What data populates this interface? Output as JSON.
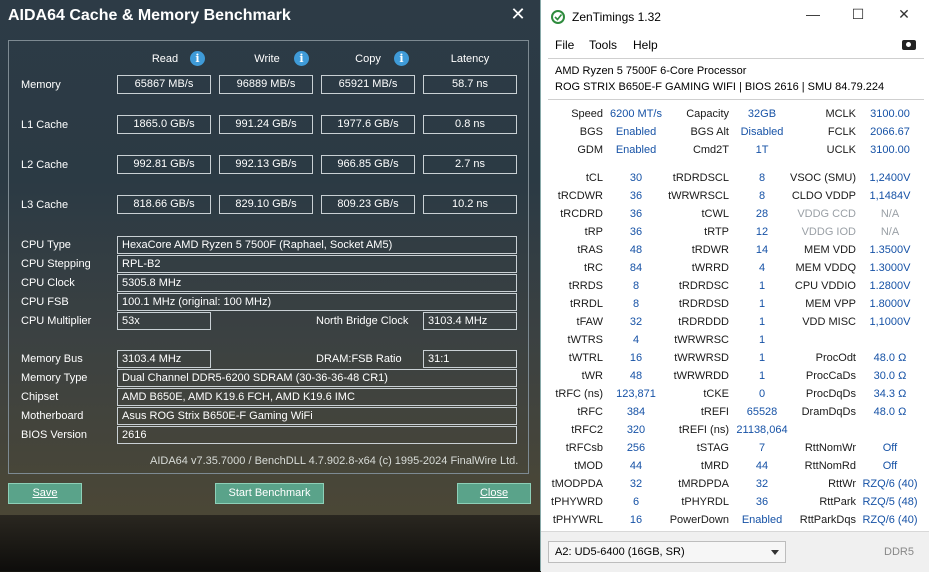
{
  "aida": {
    "title": "AIDA64 Cache & Memory Benchmark",
    "close_glyph": "✕",
    "columns": {
      "read": "Read",
      "write": "Write",
      "copy": "Copy",
      "latency": "Latency"
    },
    "info_glyph": "i",
    "rows": [
      {
        "label": "Memory",
        "read": "65867 MB/s",
        "write": "96889 MB/s",
        "copy": "65921 MB/s",
        "latency": "58.7 ns"
      },
      {
        "label": "L1 Cache",
        "read": "1865.0 GB/s",
        "write": "991.24 GB/s",
        "copy": "1977.6 GB/s",
        "latency": "0.8 ns"
      },
      {
        "label": "L2 Cache",
        "read": "992.81 GB/s",
        "write": "992.13 GB/s",
        "copy": "966.85 GB/s",
        "latency": "2.7 ns"
      },
      {
        "label": "L3 Cache",
        "read": "818.66 GB/s",
        "write": "829.10 GB/s",
        "copy": "809.23 GB/s",
        "latency": "10.2 ns"
      }
    ],
    "cpu": {
      "type_label": "CPU Type",
      "type": "HexaCore AMD Ryzen 5 7500F  (Raphael, Socket AM5)",
      "stepping_label": "CPU Stepping",
      "stepping": "RPL-B2",
      "clock_label": "CPU Clock",
      "clock": "5305.8 MHz",
      "fsb_label": "CPU FSB",
      "fsb": "100.1 MHz  (original: 100 MHz)",
      "mult_label": "CPU Multiplier",
      "mult": "53x",
      "nb_label": "North Bridge Clock",
      "nb": "3103.4 MHz"
    },
    "mem": {
      "bus_label": "Memory Bus",
      "bus": "3103.4 MHz",
      "ratio_label": "DRAM:FSB Ratio",
      "ratio": "31:1",
      "type_label": "Memory Type",
      "type": "Dual Channel DDR5-6200 SDRAM  (30-36-36-48 CR1)",
      "chipset_label": "Chipset",
      "chipset": "AMD B650E, AMD K19.6 FCH, AMD K19.6 IMC",
      "mobo_label": "Motherboard",
      "mobo": "Asus ROG Strix B650E-F Gaming WiFi",
      "bios_label": "BIOS Version",
      "bios": "2616"
    },
    "footer": "AIDA64 v7.35.7000 / BenchDLL 4.7.902.8-x64  (c) 1995-2024 FinalWire Ltd.",
    "buttons": {
      "save": "Save",
      "start": "Start Benchmark",
      "close": "Close"
    }
  },
  "zen": {
    "title": "ZenTimings 1.32",
    "window_controls": {
      "minimize": "—",
      "maximize": "☐",
      "close": "✕"
    },
    "menu": {
      "file": "File",
      "tools": "Tools",
      "help": "Help"
    },
    "cpu_name": "AMD Ryzen 5 7500F 6-Core Processor",
    "board_info": "ROG STRIX B650E-F GAMING WIFI | BIOS 2616 | SMU 84.79.224",
    "top": [
      [
        {
          "l": "Speed",
          "v": "6200 MT/s"
        },
        {
          "l": "Capacity",
          "v": "32GB"
        },
        {
          "l": "MCLK",
          "v": "3100.00"
        }
      ],
      [
        {
          "l": "BGS",
          "v": "Enabled"
        },
        {
          "l": "BGS Alt",
          "v": "Disabled"
        },
        {
          "l": "FCLK",
          "v": "2066.67"
        }
      ],
      [
        {
          "l": "GDM",
          "v": "Enabled"
        },
        {
          "l": "Cmd2T",
          "v": "1T"
        },
        {
          "l": "UCLK",
          "v": "3100.00"
        }
      ]
    ],
    "timings": [
      [
        {
          "l": "tCL",
          "v": "30"
        },
        {
          "l": "tRDRDSCL",
          "v": "8"
        },
        {
          "l": "VSOC (SMU)",
          "v": "1,2400V"
        }
      ],
      [
        {
          "l": "tRCDWR",
          "v": "36"
        },
        {
          "l": "tWRWRSCL",
          "v": "8"
        },
        {
          "l": "CLDO VDDP",
          "v": "1,1484V"
        }
      ],
      [
        {
          "l": "tRCDRD",
          "v": "36"
        },
        {
          "l": "tCWL",
          "v": "28"
        },
        {
          "l": "VDDG CCD",
          "v": "N/A",
          "dim": true
        }
      ],
      [
        {
          "l": "tRP",
          "v": "36"
        },
        {
          "l": "tRTP",
          "v": "12"
        },
        {
          "l": "VDDG IOD",
          "v": "N/A",
          "dim": true
        }
      ],
      [
        {
          "l": "tRAS",
          "v": "48"
        },
        {
          "l": "tRDWR",
          "v": "14"
        },
        {
          "l": "MEM VDD",
          "v": "1.3500V"
        }
      ],
      [
        {
          "l": "tRC",
          "v": "84"
        },
        {
          "l": "tWRRD",
          "v": "4"
        },
        {
          "l": "MEM VDDQ",
          "v": "1.3000V"
        }
      ],
      [
        {
          "l": "tRRDS",
          "v": "8"
        },
        {
          "l": "tRDRDSC",
          "v": "1"
        },
        {
          "l": "CPU VDDIO",
          "v": "1.2800V"
        }
      ],
      [
        {
          "l": "tRRDL",
          "v": "8"
        },
        {
          "l": "tRDRDSD",
          "v": "1"
        },
        {
          "l": "MEM VPP",
          "v": "1.8000V"
        }
      ],
      [
        {
          "l": "tFAW",
          "v": "32"
        },
        {
          "l": "tRDRDDD",
          "v": "1"
        },
        {
          "l": "VDD MISC",
          "v": "1,1000V"
        }
      ],
      [
        {
          "l": "tWTRS",
          "v": "4"
        },
        {
          "l": "tWRWRSC",
          "v": "1"
        },
        null
      ],
      [
        {
          "l": "tWTRL",
          "v": "16"
        },
        {
          "l": "tWRWRSD",
          "v": "1"
        },
        {
          "l": "ProcOdt",
          "v": "48.0 Ω"
        }
      ],
      [
        {
          "l": "tWR",
          "v": "48"
        },
        {
          "l": "tWRWRDD",
          "v": "1"
        },
        {
          "l": "ProcCaDs",
          "v": "30.0 Ω"
        }
      ],
      [
        {
          "l": "tRFC (ns)",
          "v": "123,871"
        },
        {
          "l": "tCKE",
          "v": "0"
        },
        {
          "l": "ProcDqDs",
          "v": "34.3 Ω"
        }
      ],
      [
        {
          "l": "tRFC",
          "v": "384"
        },
        {
          "l": "tREFI",
          "v": "65528"
        },
        {
          "l": "DramDqDs",
          "v": "48.0 Ω"
        }
      ],
      [
        {
          "l": "tRFC2",
          "v": "320"
        },
        {
          "l": "tREFI (ns)",
          "v": "21138,064"
        },
        null
      ],
      [
        {
          "l": "tRFCsb",
          "v": "256"
        },
        {
          "l": "tSTAG",
          "v": "7"
        },
        {
          "l": "RttNomWr",
          "v": "Off"
        }
      ],
      [
        {
          "l": "tMOD",
          "v": "44"
        },
        {
          "l": "tMRD",
          "v": "44"
        },
        {
          "l": "RttNomRd",
          "v": "Off"
        }
      ],
      [
        {
          "l": "tMODPDA",
          "v": "32"
        },
        {
          "l": "tMRDPDA",
          "v": "32"
        },
        {
          "l": "RttWr",
          "v": "RZQ/6 (40)"
        }
      ],
      [
        {
          "l": "tPHYWRD",
          "v": "6"
        },
        {
          "l": "tPHYRDL",
          "v": "36"
        },
        {
          "l": "RttPark",
          "v": "RZQ/5 (48)"
        }
      ],
      [
        {
          "l": "tPHYWRL",
          "v": "16"
        },
        {
          "l": "PowerDown",
          "v": "Enabled"
        },
        {
          "l": "RttParkDqs",
          "v": "RZQ/6 (40)"
        }
      ]
    ],
    "dimm_select": "A2: UD5-6400 (16GB, SR)",
    "mem_type": "DDR5"
  }
}
